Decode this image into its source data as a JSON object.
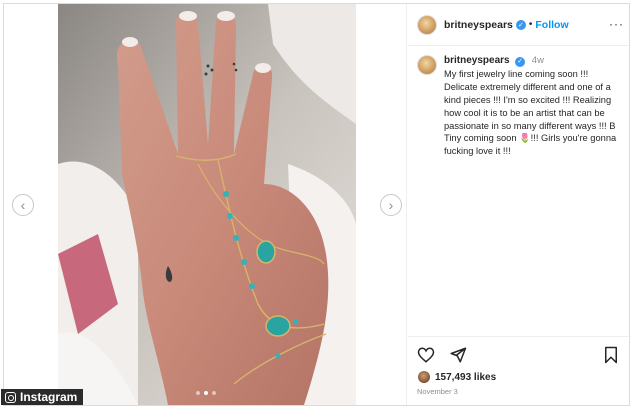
{
  "post": {
    "username": "britneyspears",
    "follow_label": "Follow",
    "separator": "•",
    "more_label": "···",
    "time_ago": "4w",
    "caption": "My first jewelry line coming soon !!! Delicate extremely different and one of a kind pieces !!! I'm so excited !!! Realizing how cool it is to be an artist that can be passionate in so many different ways !!! B Tiny coming soon 🌷!!! Girls you're gonna fucking love it !!!",
    "likes": "157,493 likes",
    "date": "November 3"
  },
  "carousel": {
    "prev_glyph": "‹",
    "next_glyph": "›",
    "slides": 3,
    "active_slide": 2
  },
  "watermark": {
    "label": "Instagram"
  },
  "colors": {
    "accent": "#0095f6",
    "verified": "#3897f0",
    "text": "#262626",
    "muted": "#8e8e8e"
  },
  "icons": [
    "heart-icon",
    "share-icon",
    "bookmark-icon",
    "verified-icon",
    "chevron-left-icon",
    "chevron-right-icon"
  ]
}
